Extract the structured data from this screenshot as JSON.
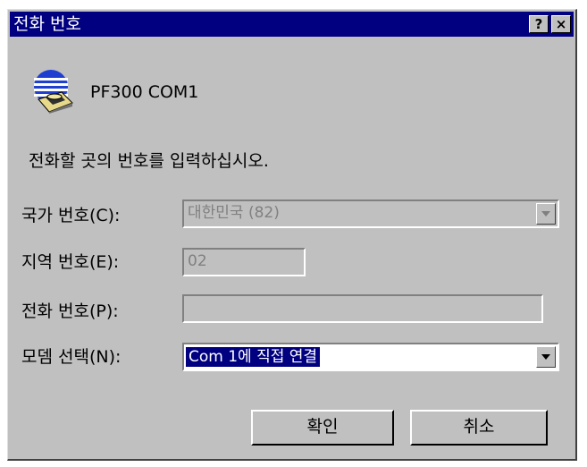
{
  "dialog": {
    "title": "전화 번호",
    "help_label": "?",
    "close_label": "×"
  },
  "modem": {
    "name": "PF300 COM1",
    "icon": "modem-phone-icon"
  },
  "instruction": "전화할 곳의 번호를 입력하십시오.",
  "country": {
    "label": "국가 번호(C):",
    "value": "대한민국 (82)"
  },
  "area": {
    "label": "지역 번호(E):",
    "value": "02"
  },
  "phone": {
    "label": "전화 번호(P):",
    "value": ""
  },
  "modem_select": {
    "label": "모뎀 선택(N):",
    "value": "Com 1에 직접 연결"
  },
  "buttons": {
    "ok": "확인",
    "cancel": "취소"
  }
}
